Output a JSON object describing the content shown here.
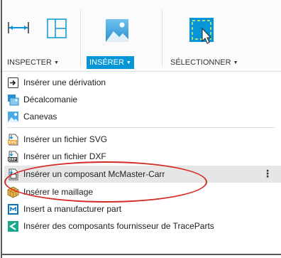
{
  "toolbar": {
    "groups": [
      {
        "label": "INSPECTER",
        "icon": "measure-icon",
        "active": false
      },
      {
        "label": "INSÉRER",
        "icon": "insert-image-icon",
        "active": true
      },
      {
        "label": "SÉLECTIONNER",
        "icon": "select-cursor-icon",
        "active": false
      }
    ]
  },
  "menu": {
    "items": [
      {
        "label": "Insérer une dérivation",
        "icon": "insert-derive-icon"
      },
      {
        "label": "Décalcomanie",
        "icon": "decal-icon"
      },
      {
        "label": "Canevas",
        "icon": "canvas-icon"
      },
      {
        "label": "Insérer un fichier SVG",
        "icon": "svg-file-icon"
      },
      {
        "label": "Insérer un fichier DXF",
        "icon": "dxf-file-icon"
      },
      {
        "label": "Insérer un composant McMaster-Carr",
        "icon": "mcmaster-icon",
        "highlighted": true
      },
      {
        "label": "Insérer le maillage",
        "icon": "mesh-icon"
      },
      {
        "label": "Insert a manufacturer part",
        "icon": "manufacturer-part-icon"
      },
      {
        "label": "Insérer des composants fournisseur de TraceParts",
        "icon": "traceparts-icon"
      }
    ],
    "more_label": "⋮"
  },
  "colors": {
    "accent": "#0696d7",
    "highlight_row": "#e6e6e6",
    "annotation_ring": "#d42a26"
  }
}
